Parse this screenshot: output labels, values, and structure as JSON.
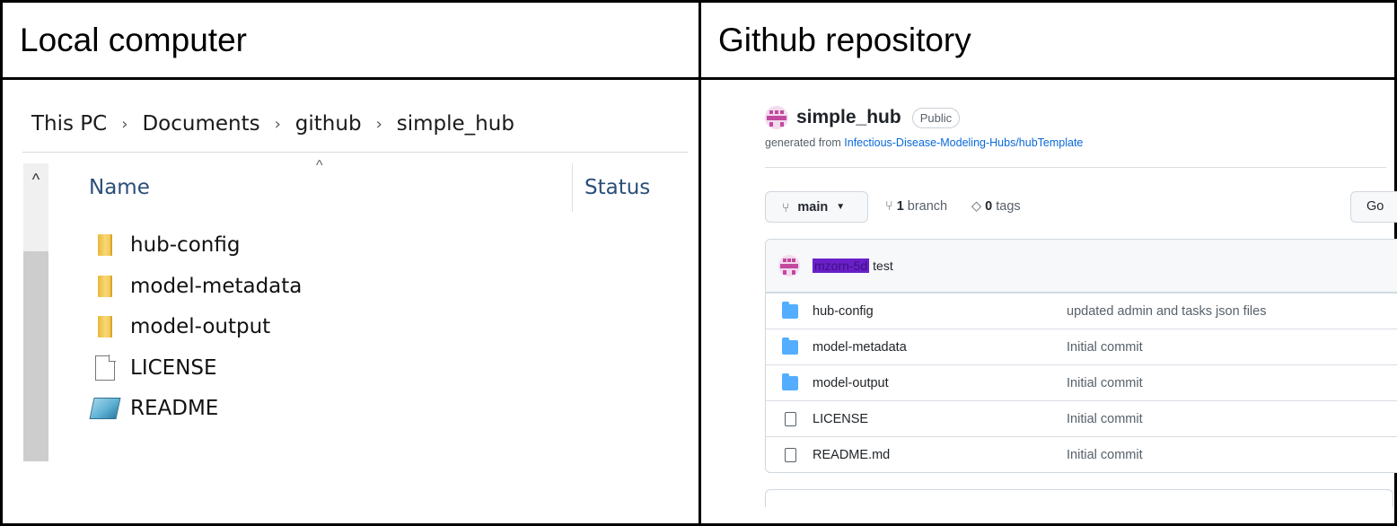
{
  "headers": {
    "left": "Local computer",
    "right": "Github repository"
  },
  "explorer": {
    "breadcrumb": [
      "This PC",
      "Documents",
      "github",
      "simple_hub"
    ],
    "breadcrumb_separator": "›",
    "columns": {
      "name": "Name",
      "status": "Status"
    },
    "sort_indicator": "^",
    "scroll_up_glyph": "^",
    "items": [
      {
        "label": "hub-config",
        "icon": "folder-icon"
      },
      {
        "label": "model-metadata",
        "icon": "folder-icon"
      },
      {
        "label": "model-output",
        "icon": "folder-icon"
      },
      {
        "label": "LICENSE",
        "icon": "file-icon"
      },
      {
        "label": "README",
        "icon": "readme-icon"
      }
    ]
  },
  "github": {
    "repo_name": "simple_hub",
    "visibility": "Public",
    "generated_from_prefix": "generated from",
    "generated_from_link": "Infectious-Disease-Modeling-Hubs/hubTemplate",
    "branch": "main",
    "branch_count": "1",
    "branch_label": "branch",
    "tag_count": "0",
    "tag_label": "tags",
    "goto_label": "Go",
    "commit": {
      "author": "mzorn-5d",
      "message": "test"
    },
    "files": [
      {
        "name": "hub-config",
        "type": "folder",
        "message": "updated admin and tasks json files"
      },
      {
        "name": "model-metadata",
        "type": "folder",
        "message": "Initial commit"
      },
      {
        "name": "model-output",
        "type": "folder",
        "message": "Initial commit"
      },
      {
        "name": "LICENSE",
        "type": "file",
        "message": "Initial commit"
      },
      {
        "name": "README.md",
        "type": "file",
        "message": "Initial commit"
      }
    ],
    "colors": {
      "link": "#0969da",
      "folder": "#54aeff",
      "avatar": "#c2499e",
      "redaction": "#6a1fc9"
    }
  }
}
